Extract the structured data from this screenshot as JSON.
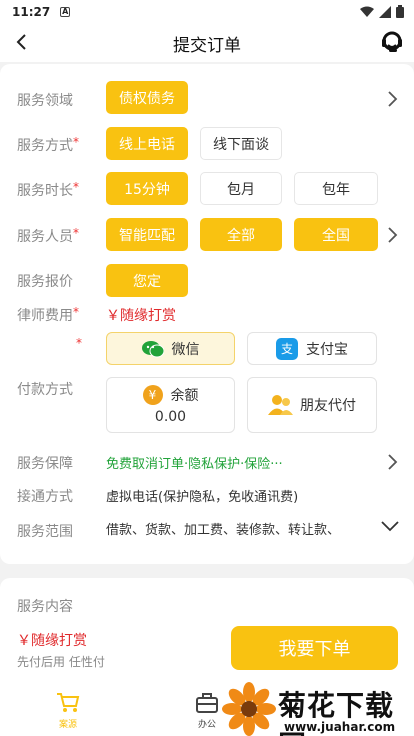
{
  "status": {
    "time": "11:27",
    "a_icon": "A"
  },
  "nav": {
    "title": "提交订单"
  },
  "form": {
    "domain": {
      "label": "服务领域",
      "options": [
        "债权债务"
      ]
    },
    "method": {
      "label": "服务方式",
      "options": [
        "线上电话",
        "线下面谈"
      ],
      "selected": "线上电话"
    },
    "duration": {
      "label": "服务时长",
      "options": [
        "15分钟",
        "包月",
        "包年"
      ],
      "selected": "15分钟"
    },
    "personnel": {
      "label": "服务人员",
      "options": [
        "智能匹配",
        "全部",
        "全国"
      ]
    },
    "quote": {
      "label": "服务报价",
      "value": "您定"
    },
    "fee": {
      "label": "律师费用",
      "value": "￥随缘打赏"
    },
    "payment": {
      "label": "付款方式",
      "wechat": "微信",
      "alipay": "支付宝",
      "balance_label": "余额",
      "balance_value": "0.00",
      "friend": "朋友代付",
      "yen_symbol": "¥",
      "alipay_glyph": "支"
    },
    "guarantee": {
      "label": "服务保障",
      "value": "免费取消订单·隐私保护·保险···"
    },
    "connect": {
      "label": "接通方式",
      "value": "虚拟电话(保护隐私，免收通讯费)"
    },
    "scope": {
      "label": "服务范围",
      "value": "借款、货款、加工费、装修款、转让款、"
    },
    "required_mark": "*"
  },
  "content": {
    "label": "服务内容"
  },
  "footer": {
    "price": "￥随缘打赏",
    "note": "先付后用 任性付",
    "order_button": "我要下单"
  },
  "tabs": [
    {
      "label": "案源"
    },
    {
      "label": "办公"
    }
  ],
  "watermark": {
    "brand": "菊花下载网",
    "url": "www.juahar.com"
  },
  "colors": {
    "accent": "#f9c211",
    "red": "#e0292b",
    "green": "#22a33a"
  }
}
